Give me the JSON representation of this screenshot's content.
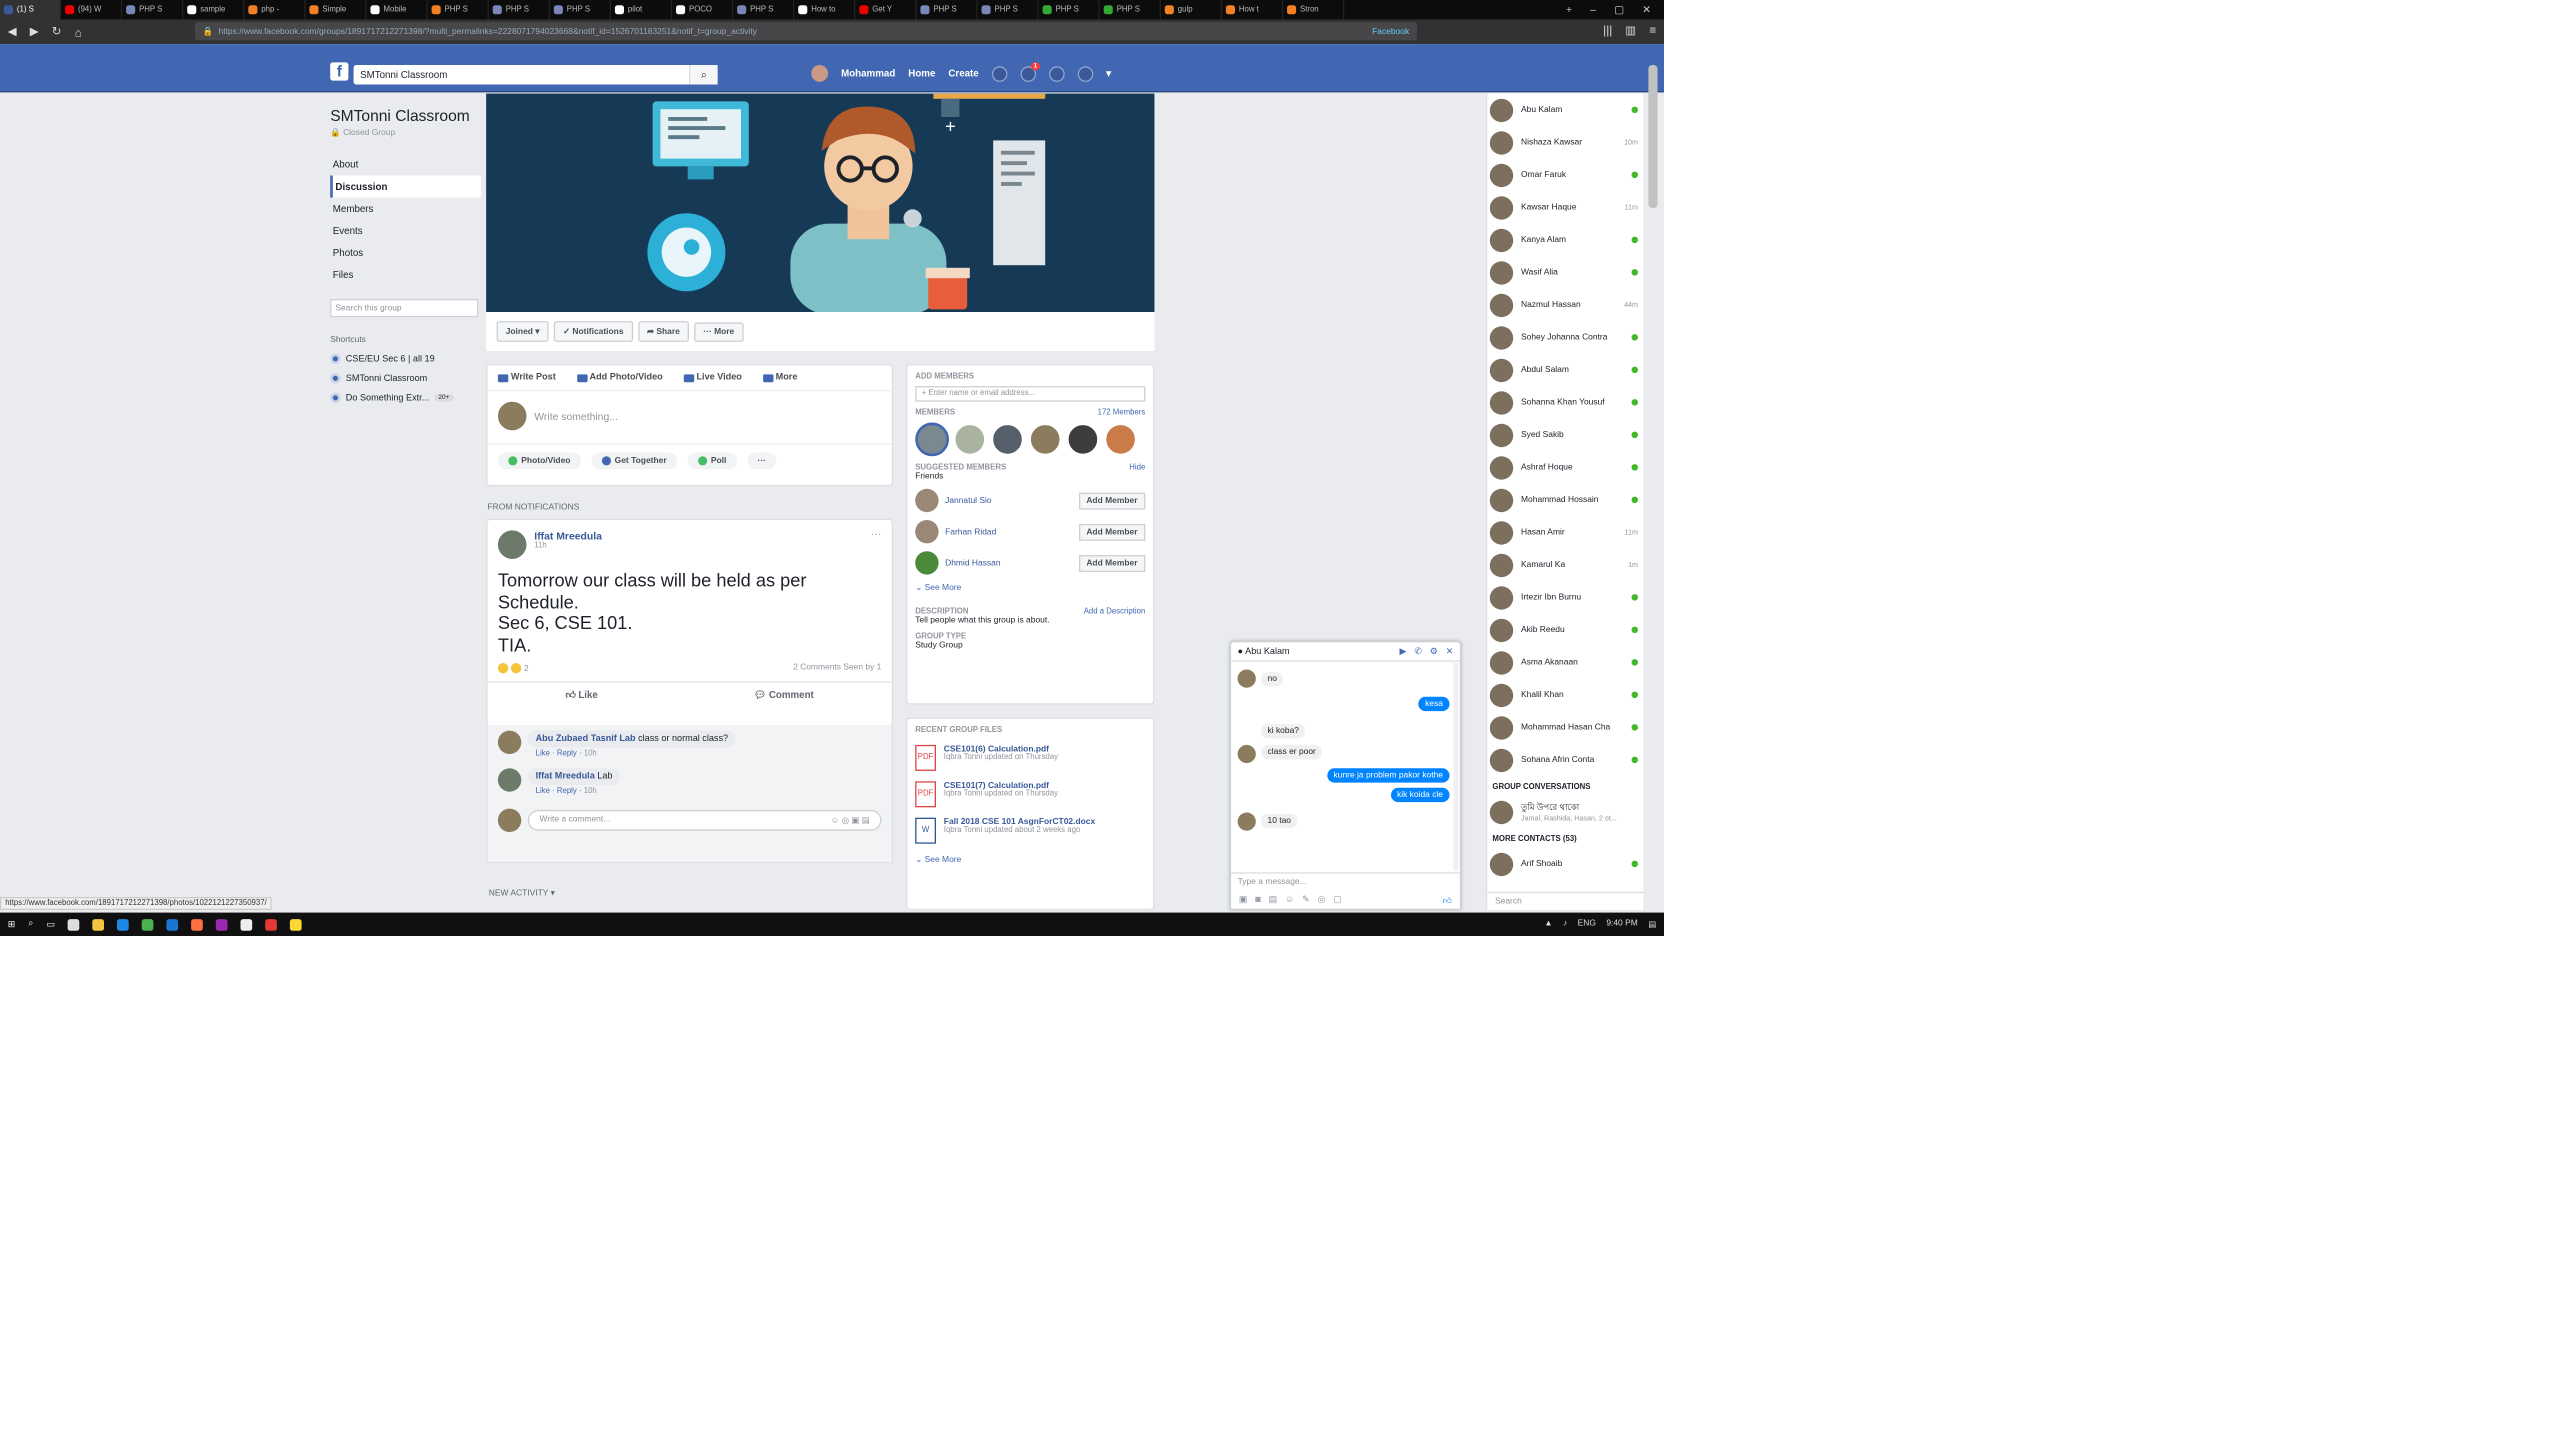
{
  "browser": {
    "tabs": [
      {
        "label": "(1) S",
        "color": "#3b5998",
        "active": true
      },
      {
        "label": "(94) W",
        "color": "#e00"
      },
      {
        "label": "PHP S",
        "color": "#7a86b8"
      },
      {
        "label": "sample",
        "color": "#fff"
      },
      {
        "label": "php -",
        "color": "#f48024"
      },
      {
        "label": "Simple",
        "color": "#f48024"
      },
      {
        "label": "Mobile",
        "color": "#fff"
      },
      {
        "label": "PHP S",
        "color": "#f48024"
      },
      {
        "label": "PHP S",
        "color": "#7a86b8"
      },
      {
        "label": "PHP S",
        "color": "#7a86b8"
      },
      {
        "label": "pilot",
        "color": "#fff"
      },
      {
        "label": "POCO",
        "color": "#fff"
      },
      {
        "label": "PHP S",
        "color": "#7a86b8"
      },
      {
        "label": "How to",
        "color": "#fff"
      },
      {
        "label": "Get Y",
        "color": "#e00"
      },
      {
        "label": "PHP S",
        "color": "#7a86b8"
      },
      {
        "label": "PHP S",
        "color": "#7a86b8"
      },
      {
        "label": "PHP S",
        "color": "#3a3"
      },
      {
        "label": "PHP S",
        "color": "#3a3"
      },
      {
        "label": "gulp",
        "color": "#f48024"
      },
      {
        "label": "How t",
        "color": "#f48024"
      },
      {
        "label": "Stron",
        "color": "#f48024"
      }
    ],
    "url": "https://www.facebook.com/groups/1891717212271398/?multi_permalinks=2228071794023668&notif_id=1526701183251&notif_t=group_activity",
    "container_label": "Facebook"
  },
  "fb": {
    "search_value": "SMTonni Classroom",
    "user_name": "Mohammad",
    "nav_home": "Home",
    "nav_create": "Create",
    "friend_badge": "1"
  },
  "group": {
    "name": "SMTonni Classroom",
    "type": "Closed Group",
    "nav": [
      "About",
      "Discussion",
      "Members",
      "Events",
      "Photos",
      "Files"
    ],
    "search_placeholder": "Search this group",
    "shortcuts_title": "Shortcuts",
    "shortcuts": [
      {
        "label": "CSE/EU Sec 6 | all 19",
        "badge": ""
      },
      {
        "label": "SMTonni Classroom",
        "badge": ""
      },
      {
        "label": "Do Something Extr...",
        "badge": "20+"
      }
    ]
  },
  "cover_actions": {
    "joined": "Joined ▾",
    "notifications": "✓ Notifications",
    "share": "➦ Share",
    "more": "··· More"
  },
  "composer": {
    "tabs": [
      "Write Post",
      "Add Photo/Video",
      "Live Video",
      "More"
    ],
    "placeholder": "Write something...",
    "actions": [
      "Photo/Video",
      "Get Together",
      "Poll",
      "···"
    ]
  },
  "from_notifications": "FROM NOTIFICATIONS",
  "post": {
    "author": "Iffat Mreedula",
    "time": "11h",
    "text": "Tomorrow our class will be held as per\nSchedule.\nSec 6, CSE 101.\nTIA.",
    "reactions_count": "2",
    "stats": "2 Comments  Seen by 1",
    "like": "Like",
    "comment": "Comment"
  },
  "comments": [
    {
      "author": "Abu Zubaed Tasnif Lab",
      "text": "class or normal class?",
      "like": "Like",
      "reply": "Reply",
      "time": "10h"
    },
    {
      "author": "Iffat Mreedula",
      "text": "Lab",
      "like": "Like",
      "reply": "Reply",
      "time": "10h"
    }
  ],
  "write_comment": "Write a comment...",
  "new_activity": "NEW ACTIVITY ▾",
  "add_members": {
    "title": "ADD MEMBERS",
    "placeholder": "+ Enter name or email address...",
    "members_title": "MEMBERS",
    "members_count": "172 Members",
    "suggested_title": "SUGGESTED MEMBERS",
    "suggested_hide": "Hide",
    "friends_label": "Friends",
    "suggested": [
      {
        "name": "Jannatul Sio",
        "button": "Add Member"
      },
      {
        "name": "Farhan Ridad",
        "button": "Add Member"
      },
      {
        "name": "Dhmid Hassan",
        "button": "Add Member"
      }
    ],
    "see_more": "See More",
    "description_title": "DESCRIPTION",
    "description_link": "Add a Description",
    "description_text": "Tell people what this group is about.",
    "group_type_title": "GROUP TYPE",
    "group_type": "Study Group"
  },
  "files": {
    "title": "RECENT GROUP FILES",
    "items": [
      {
        "name": "CSE101(6) Calculation.pdf",
        "meta": "Iqbra Tonni updated on Thursday",
        "type": "pdf"
      },
      {
        "name": "CSE101(7) Calculation.pdf",
        "meta": "Iqbra Tonni updated on Thursday",
        "type": "pdf"
      },
      {
        "name": "Fall 2018 CSE 101 AsgnForCT02.docx",
        "meta": "Iqbra Tonni updated about 2 weeks ago",
        "type": "doc"
      }
    ],
    "see_more": "See More"
  },
  "chat": {
    "name": "● Abu Kalam",
    "messages": [
      {
        "dir": "in",
        "text": "no"
      },
      {
        "dir": "out",
        "text": "kesa"
      },
      {
        "dir": "in",
        "text": "ki koba?"
      },
      {
        "dir": "in",
        "text": "class er poor"
      },
      {
        "dir": "out",
        "text": "kunre ja problem pakor kothe"
      },
      {
        "dir": "out",
        "text": "kik koida cle"
      },
      {
        "dir": "in",
        "text": "10 tao"
      }
    ],
    "input_placeholder": "Type a message..."
  },
  "contacts": {
    "list": [
      {
        "name": "Abu Kalam",
        "status": "",
        "online": true
      },
      {
        "name": "Nishaza Kawsar",
        "status": "10m",
        "online": false
      },
      {
        "name": "Omar Faruk",
        "status": "",
        "online": true
      },
      {
        "name": "Kawsar Haque",
        "status": "11m",
        "online": false
      },
      {
        "name": "Kanya Alam",
        "status": "",
        "online": true
      },
      {
        "name": "Wasif Alia",
        "status": "",
        "online": true
      },
      {
        "name": "Nazmul Hassan",
        "status": "44m",
        "online": false
      },
      {
        "name": "Sohey Johanna Contra",
        "status": "",
        "online": true
      },
      {
        "name": "Abdul Salam",
        "status": "",
        "online": true
      },
      {
        "name": "Sohanna Khan Yousuf",
        "status": "",
        "online": true
      },
      {
        "name": "Syed Sakib",
        "status": "",
        "online": true
      },
      {
        "name": "Ashraf Hoque",
        "status": "",
        "online": true
      },
      {
        "name": "Mohammad Hossain",
        "status": "",
        "online": true
      },
      {
        "name": "Hasan Amir",
        "status": "11m",
        "online": false
      },
      {
        "name": "Kamarul Ka",
        "status": "1m",
        "online": false
      },
      {
        "name": "Irtezir Ibn Burnu",
        "status": "",
        "online": true
      },
      {
        "name": "Akib Reedu",
        "status": "",
        "online": true
      },
      {
        "name": "Asma Akanaan",
        "status": "",
        "online": true
      },
      {
        "name": "Khalil Khan",
        "status": "",
        "online": true
      },
      {
        "name": "Mohammad Hasan Cha",
        "status": "",
        "online": true
      },
      {
        "name": "Sohana Afrin Conta",
        "status": "",
        "online": true
      }
    ],
    "group_conv_title": "GROUP CONVERSATIONS",
    "group_conv": {
      "name": "তুমি উপরে থাকো",
      "sub": "Jamal, Rashida, Hasan, 2 ot..."
    },
    "more_title": "MORE CONTACTS (53)",
    "more": [
      {
        "name": "Arif Shoaib",
        "online": true
      }
    ],
    "search_placeholder": "Search"
  },
  "status_url": "https://www.facebook.com/1891717212271398/photos/1022121227350937/",
  "taskbar": {
    "time": "9:40 PM",
    "lang": "ENG"
  }
}
